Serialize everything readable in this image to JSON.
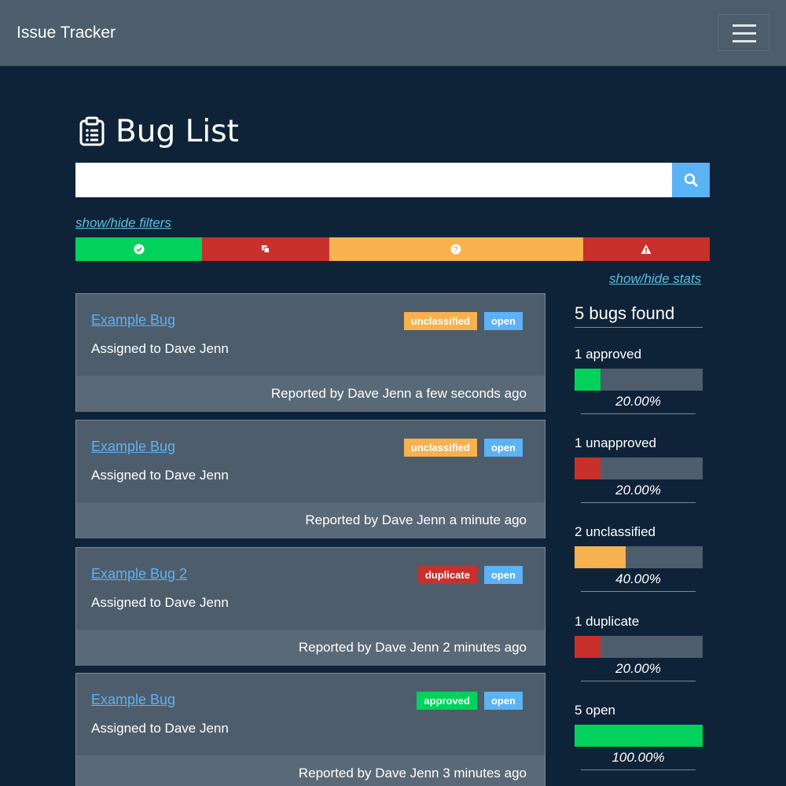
{
  "colors": {
    "approved": "#00d25b",
    "unapproved": "#c9302c",
    "unclassified": "#f7b14e",
    "duplicate": "#c9302c",
    "open": "#5bb2f5",
    "navbar": "#4e5d6c",
    "background": "#0f2338"
  },
  "navbar": {
    "brand": "Issue Tracker",
    "menu_icon": "hamburger-icon"
  },
  "header": {
    "title": "Bug List",
    "icon": "clipboard-list-icon"
  },
  "search": {
    "value": "",
    "placeholder": "",
    "button_icon": "search-icon"
  },
  "filters_link": "show/hide filters",
  "stats_link": "show/hide stats",
  "status_bar": [
    {
      "key": "approved",
      "icon": "check-circle-icon",
      "color": "#00d25b",
      "fraction": 0.2
    },
    {
      "key": "unapproved",
      "icon": "copy-icon",
      "color": "#c9302c",
      "fraction": 0.2
    },
    {
      "key": "unclassified",
      "icon": "question-circle-icon",
      "color": "#f7b14e",
      "fraction": 0.4
    },
    {
      "key": "duplicate",
      "icon": "warning-icon",
      "color": "#c9302c",
      "fraction": 0.2
    }
  ],
  "bugs": [
    {
      "title": "Example Bug",
      "assigned": "Assigned to Dave Jenn",
      "labels": [
        {
          "text": "unclassified",
          "color": "#f7b14e"
        },
        {
          "text": "open",
          "color": "#5bb2f5"
        }
      ],
      "reported": "Reported by Dave Jenn a few seconds ago"
    },
    {
      "title": "Example Bug",
      "assigned": "Assigned to Dave Jenn",
      "labels": [
        {
          "text": "unclassified",
          "color": "#f7b14e"
        },
        {
          "text": "open",
          "color": "#5bb2f5"
        }
      ],
      "reported": "Reported by Dave Jenn a minute ago"
    },
    {
      "title": "Example Bug 2",
      "assigned": "Assigned to Dave Jenn",
      "labels": [
        {
          "text": "duplicate",
          "color": "#c9302c"
        },
        {
          "text": "open",
          "color": "#5bb2f5"
        }
      ],
      "reported": "Reported by Dave Jenn 2 minutes ago"
    },
    {
      "title": "Example Bug",
      "assigned": "Assigned to Dave Jenn",
      "labels": [
        {
          "text": "approved",
          "color": "#00d25b"
        },
        {
          "text": "open",
          "color": "#5bb2f5"
        }
      ],
      "reported": "Reported by Dave Jenn 3 minutes ago"
    }
  ],
  "stats": {
    "heading": "5 bugs found",
    "items": [
      {
        "label": "1 approved",
        "percent_text": "20.00%",
        "fraction": 0.2,
        "color": "#00d25b"
      },
      {
        "label": "1 unapproved",
        "percent_text": "20.00%",
        "fraction": 0.2,
        "color": "#c9302c"
      },
      {
        "label": "2 unclassified",
        "percent_text": "40.00%",
        "fraction": 0.4,
        "color": "#f7b14e"
      },
      {
        "label": "1 duplicate",
        "percent_text": "20.00%",
        "fraction": 0.2,
        "color": "#c9302c"
      },
      {
        "label": "5 open",
        "percent_text": "100.00%",
        "fraction": 1.0,
        "color": "#00d25b"
      }
    ]
  }
}
